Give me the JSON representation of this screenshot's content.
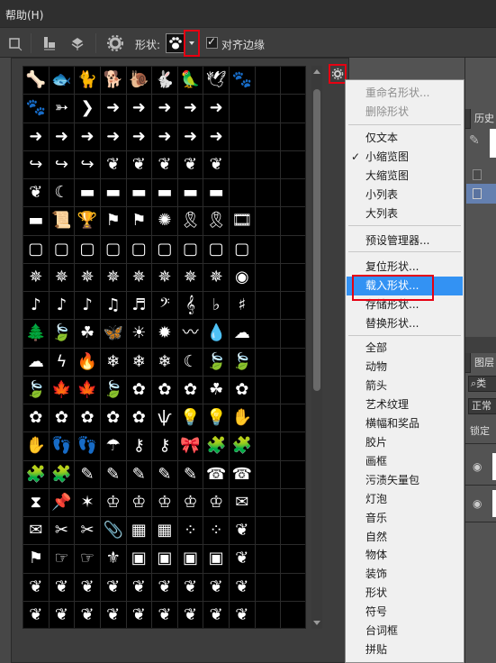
{
  "menubar": {
    "help": "帮助(H)"
  },
  "options_bar": {
    "shape_label": "形状:",
    "align_edges_label": "对齐边缘",
    "align_edges_checked": true
  },
  "shape_grid": {
    "rows": [
      [
        "bone-icon",
        "fish-icon",
        "cat-icon",
        "dog-icon",
        "snail-icon",
        "rabbit-icon",
        "parrot-icon",
        "dove-icon",
        "paw-icon"
      ],
      [
        "paw-print-icon",
        "arrow-icon",
        "chevron-right-icon",
        "arrow-right-icon",
        "arrow-right-icon",
        "arrow-right-icon",
        "arrow-right-icon",
        "arrow-right-icon"
      ],
      [
        "arrow-right-icon",
        "arrow-right-icon",
        "arrow-right-icon",
        "arrow-right-icon",
        "arrow-right-icon",
        "arrow-right-icon",
        "arrow-right-icon",
        "arrow-right-icon"
      ],
      [
        "curved-arrow-icon",
        "curved-arrow-icon",
        "curved-arrow-icon",
        "ornament-icon",
        "ornament-icon",
        "ornament-icon",
        "ornament-icon",
        "ornament-icon"
      ],
      [
        "ornament-icon",
        "moon-icon",
        "banner-icon",
        "banner-icon",
        "banner-icon",
        "banner-icon",
        "banner-icon",
        "banner-icon"
      ],
      [
        "banner-icon",
        "scroll-icon",
        "trophy-icon",
        "flag-icon",
        "flag-icon",
        "seal-icon",
        "ribbon-icon",
        "ribbon-icon",
        "film-icon"
      ],
      [
        "frame-icon",
        "frame-icon",
        "frame-icon",
        "frame-icon",
        "frame-icon",
        "frame-icon",
        "frame-icon",
        "frame-icon",
        "frame-icon"
      ],
      [
        "splatter-icon",
        "splatter-icon",
        "splatter-icon",
        "splatter-icon",
        "splatter-icon",
        "splatter-icon",
        "splatter-icon",
        "splatter-icon",
        "eye-icon"
      ],
      [
        "eighth-note-icon",
        "eighth-note-icon",
        "eighth-note-icon",
        "beamed-notes-icon",
        "sixteenth-note-icon",
        "bass-clef-icon",
        "treble-clef-icon",
        "flat-icon",
        "sharp-icon"
      ],
      [
        "tree-icon",
        "leaf-icon",
        "clover-icon",
        "butterfly-icon",
        "sun-icon",
        "star-burst-icon",
        "wave-icon",
        "drop-icon",
        "cloud-icon"
      ],
      [
        "cloud-icon",
        "lightning-icon",
        "fire-icon",
        "snowflake-icon",
        "snowflake-icon",
        "snowflake-icon",
        "moon-icon",
        "leaf-icon",
        "leaf-icon"
      ],
      [
        "leaf-icon",
        "maple-leaf-icon",
        "maple-leaf-icon",
        "leaf-icon",
        "flower-icon",
        "flower-icon",
        "flower-icon",
        "clover-icon",
        "flower-icon"
      ],
      [
        "flower-icon",
        "flower-icon",
        "flower-icon",
        "flower-icon",
        "flower-icon",
        "grass-icon",
        "lightbulb-icon",
        "lightbulb-icon",
        "hand-icon"
      ],
      [
        "hand-icon",
        "footprint-icon",
        "footprint-icon",
        "umbrella-icon",
        "key-icon",
        "key-icon",
        "bow-icon",
        "puzzle-icon",
        "puzzle-icon"
      ],
      [
        "puzzle-icon",
        "puzzle-icon",
        "pencil-icon",
        "pencil-icon",
        "pencil-icon",
        "pencil-icon",
        "pencil-icon",
        "telephone-icon",
        "telephone-icon"
      ],
      [
        "hourglass-icon",
        "pushpin-icon",
        "star-icon",
        "crown-icon",
        "crown-icon",
        "crown-icon",
        "crown-icon",
        "crown-icon",
        "envelope-icon"
      ],
      [
        "envelope-icon",
        "scissors-icon",
        "scissors-icon",
        "paperclip-icon",
        "stamp-icon",
        "stamp-icon",
        "texture-icon",
        "texture-icon",
        "ornament-icon"
      ],
      [
        "flag-icon",
        "hand-pointer-icon",
        "hand-pointer-icon",
        "fleur-de-lis-icon",
        "tile-icon",
        "tile-icon",
        "tile-icon",
        "tile-icon",
        "ornament-icon"
      ],
      [
        "ornament-icon",
        "ornament-icon",
        "ornament-icon",
        "ornament-icon",
        "ornament-icon",
        "ornament-icon",
        "ornament-icon",
        "ornament-icon",
        "ornament-icon"
      ],
      [
        "ornament-icon",
        "ornament-icon",
        "ornament-icon",
        "ornament-icon",
        "ornament-icon",
        "ornament-icon",
        "ornament-icon",
        "ornament-icon",
        "ornament-icon"
      ]
    ]
  },
  "panel_menu": {
    "items": [
      {
        "label": "重命名形状...",
        "disabled": true
      },
      {
        "label": "删除形状",
        "disabled": true
      },
      {
        "label": "仅文本"
      },
      {
        "label": "小缩览图",
        "checked": true
      },
      {
        "label": "大缩览图"
      },
      {
        "label": "小列表"
      },
      {
        "label": "大列表"
      },
      {
        "label": "预设管理器..."
      },
      {
        "label": "复位形状..."
      },
      {
        "label": "载入形状...",
        "highlighted": true
      },
      {
        "label": "存储形状..."
      },
      {
        "label": "替换形状..."
      },
      {
        "label": "全部"
      },
      {
        "label": "动物"
      },
      {
        "label": "箭头"
      },
      {
        "label": "艺术纹理"
      },
      {
        "label": "横幅和奖品"
      },
      {
        "label": "胶片"
      },
      {
        "label": "画框"
      },
      {
        "label": "污渍矢量包"
      },
      {
        "label": "灯泡"
      },
      {
        "label": "音乐"
      },
      {
        "label": "自然"
      },
      {
        "label": "物体"
      },
      {
        "label": "装饰"
      },
      {
        "label": "形状"
      },
      {
        "label": "符号"
      },
      {
        "label": "台词框"
      },
      {
        "label": "拼贴"
      }
    ]
  },
  "right_panel": {
    "history_tab": "历史",
    "layers_tab": "图层",
    "kind_label": "类",
    "blend_mode": "正常",
    "lock_label": "锁定"
  },
  "colors": {
    "highlight": "#3392f3",
    "callout_red": "#e60012"
  }
}
